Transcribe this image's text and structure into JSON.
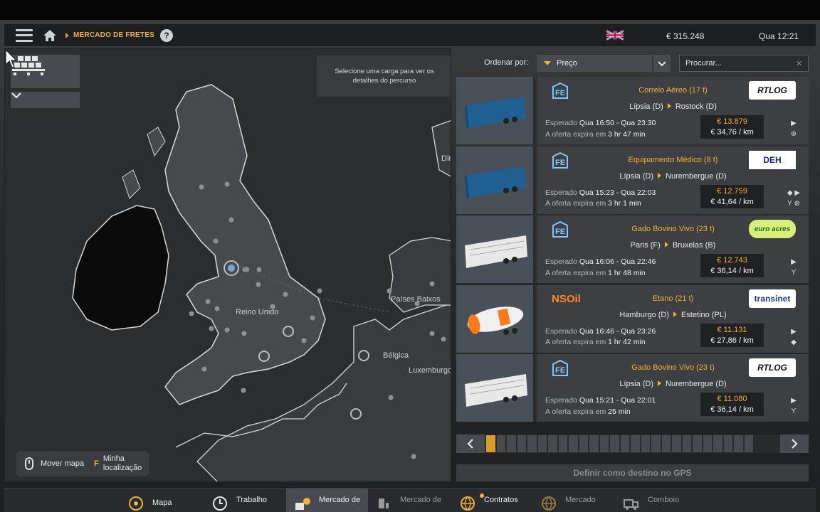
{
  "topbar": {
    "breadcrumb": "MERCADO DE FRETES",
    "help": "?",
    "money": "€ 315.248",
    "clock": "Qua 12:21"
  },
  "map": {
    "tooltip": "Selecione uma carga para ver os detalhes do percurso",
    "labels": {
      "reino_unido": "Reino Unido",
      "paises_baixos": "Países Baixos",
      "belgica": "Bélgica",
      "luxemburgo": "Luxemburgo",
      "din": "Din"
    },
    "help": {
      "move": "Mover mapa",
      "key": "F",
      "locate_line1": "Minha",
      "locate_line2": "localização"
    }
  },
  "sort": {
    "label": "Ordenar por:",
    "value": "Preço",
    "search_placeholder": "Procurar...",
    "clear": "✕"
  },
  "jobs": [
    {
      "company_logo": "FE",
      "cargo": "Correio Aéreo (17 t)",
      "origin": "Lípsia (D)",
      "destination": "Rostock (D)",
      "expected_label": "Esperado",
      "expected": "Qua 16:50 - Qua 23:30",
      "expires_label": "A oferta expira em",
      "expires": "3 hr 47 min",
      "price": "€ 13.879",
      "per_km": "€ 34,76 / km",
      "client_logo": "RTLOG",
      "trailer": "blue",
      "icons": [
        "▶",
        "⊕"
      ]
    },
    {
      "company_logo": "FE",
      "cargo": "Equipamento Médico (8 t)",
      "origin": "Lípsia (D)",
      "destination": "Nurembergue (D)",
      "expected_label": "Esperado",
      "expected": "Qua 15:23 - Qua 22:03",
      "expires_label": "A oferta expira em",
      "expires": "3 hr 1 min",
      "price": "€ 12.759",
      "per_km": "€ 41,64 / km",
      "client_logo": "DEH",
      "trailer": "blue",
      "icons": [
        "◆ ▶",
        "Y ⊕"
      ]
    },
    {
      "company_logo": "FE",
      "cargo": "Gado Bovino Vivo (23 t)",
      "origin": "Paris (F)",
      "destination": "Bruxelas (B)",
      "expected_label": "Esperado",
      "expected": "Qua 16:06 - Qua 22:46",
      "expires_label": "A oferta expira em",
      "expires": "1 hr 48 min",
      "price": "€ 12.743",
      "per_km": "€ 36,14 / km",
      "client_logo": "euro acres",
      "trailer": "white",
      "icons": [
        "▶",
        "Y"
      ]
    },
    {
      "company_logo": "NSOil",
      "cargo": "Etano (21 t)",
      "origin": "Hamburgo (D)",
      "destination": "Estetino (PL)",
      "expected_label": "Esperado",
      "expected": "Qua 16:46 - Qua 23:26",
      "expires_label": "A oferta expira em",
      "expires": "1 hr 42 min",
      "price": "€ 11.131",
      "per_km": "€ 27,86 / km",
      "client_logo": "transinet",
      "trailer": "tank",
      "icons": [
        "▶",
        "◆"
      ]
    },
    {
      "company_logo": "FE",
      "cargo": "Gado Bovino Vivo (23 t)",
      "origin": "Lípsia (D)",
      "destination": "Nurembergue (D)",
      "expected_label": "Esperado",
      "expected": "Qua 15:21 - Qua 22:01",
      "expires_label": "A oferta expira em",
      "expires": "25 min",
      "price": "€ 11.080",
      "per_km": "€ 36,14 / km",
      "client_logo": "RTLOG",
      "trailer": "white",
      "icons": [
        "▶",
        "Y"
      ]
    }
  ],
  "pager": {
    "pages": 26,
    "current": 1
  },
  "gps_button": "Definir como destino no GPS",
  "tabs": [
    {
      "label": "Mapa",
      "icon": "gps-icon"
    },
    {
      "label": "Trabalho",
      "icon": "clock-icon"
    },
    {
      "label": "Mercado de",
      "icon": "freight-icon"
    },
    {
      "label": "Mercado de",
      "icon": "cargo-icon"
    },
    {
      "label": "Contratos",
      "icon": "globe-icon"
    },
    {
      "label": "Mercado",
      "icon": "globe-icon"
    },
    {
      "label": "Comboio",
      "icon": "truck-icon"
    }
  ]
}
